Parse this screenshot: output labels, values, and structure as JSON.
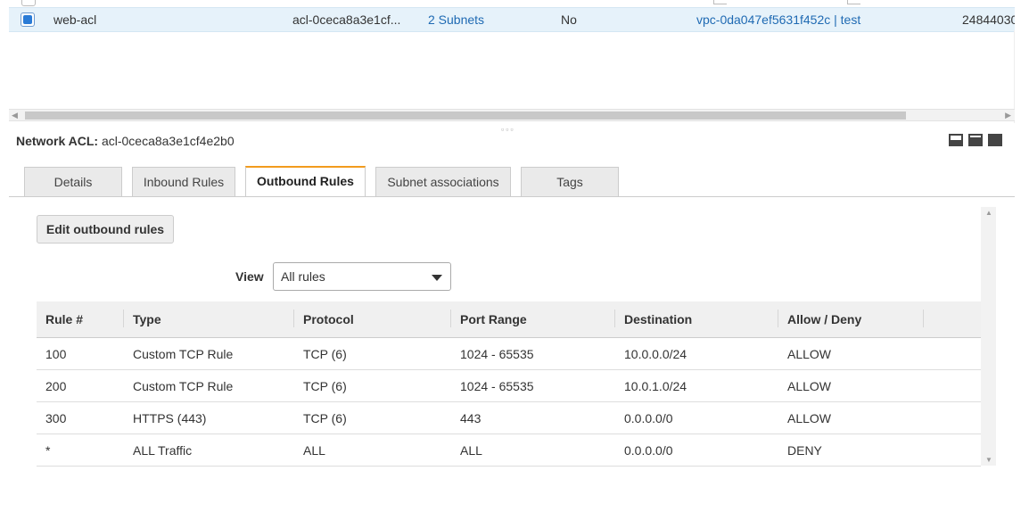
{
  "list": {
    "selected_row": {
      "name": "web-acl",
      "acl_id": "acl-0ceca8a3e1cf...",
      "subnets": "2 Subnets",
      "default": "No",
      "vpc": "vpc-0da047ef5631f452c | test",
      "owner": "24844030"
    }
  },
  "detail": {
    "header_label": "Network ACL:",
    "header_value": "acl-0ceca8a3e1cf4e2b0",
    "tabs": [
      {
        "label": "Details"
      },
      {
        "label": "Inbound Rules"
      },
      {
        "label": "Outbound Rules"
      },
      {
        "label": "Subnet associations"
      },
      {
        "label": "Tags"
      }
    ],
    "active_tab": "Outbound Rules"
  },
  "outbound": {
    "edit_button": "Edit outbound rules",
    "view_label": "View",
    "view_selected": "All rules",
    "columns": [
      "Rule #",
      "Type",
      "Protocol",
      "Port Range",
      "Destination",
      "Allow / Deny"
    ],
    "rows": [
      {
        "rule": "100",
        "type": "Custom TCP Rule",
        "protocol": "TCP (6)",
        "port": "1024 - 65535",
        "dest": "10.0.0.0/24",
        "action": "ALLOW"
      },
      {
        "rule": "200",
        "type": "Custom TCP Rule",
        "protocol": "TCP (6)",
        "port": "1024 - 65535",
        "dest": "10.0.1.0/24",
        "action": "ALLOW"
      },
      {
        "rule": "300",
        "type": "HTTPS (443)",
        "protocol": "TCP (6)",
        "port": "443",
        "dest": "0.0.0.0/0",
        "action": "ALLOW"
      },
      {
        "rule": "*",
        "type": "ALL Traffic",
        "protocol": "ALL",
        "port": "ALL",
        "dest": "0.0.0.0/0",
        "action": "DENY"
      }
    ]
  },
  "colors": {
    "allow": "#1d8102",
    "deny": "#d13212",
    "active_tab_accent": "#f29b1d",
    "link": "#1f6ab3"
  }
}
